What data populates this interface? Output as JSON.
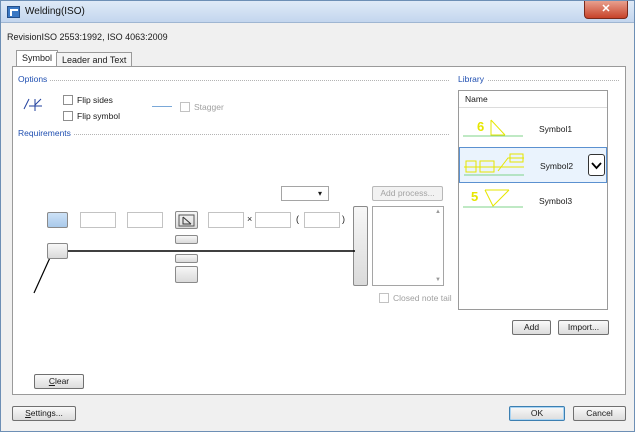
{
  "window": {
    "title": "Welding(ISO)",
    "close_glyph": "✕"
  },
  "revision": "RevisionISO 2553:1992, ISO 4063:2009",
  "tabs": [
    {
      "label": "Symbol"
    },
    {
      "label": "Leader and Text"
    }
  ],
  "options": {
    "group_label": "Options",
    "flip_sides": {
      "label": "Flip sides",
      "checked": false
    },
    "flip_symbol": {
      "label": "Flip symbol",
      "checked": false
    },
    "stagger": {
      "label": "Stagger",
      "checked": false,
      "enabled": false
    }
  },
  "requirements": {
    "group_label": "Requirements",
    "dropdown_value": "",
    "add_process_label": "Add process...",
    "times_glyph": "×",
    "paren_open": "(",
    "paren_close": ")",
    "closed_note_tail": {
      "label": "Closed note tail",
      "checked": false,
      "enabled": false
    }
  },
  "library": {
    "group_label": "Library",
    "column_header": "Name",
    "items": [
      {
        "name": "Symbol1",
        "preview_value": "6",
        "color": "#e6e600"
      },
      {
        "name": "Symbol2",
        "preview_value": "",
        "color": "#e6e600",
        "selected": true
      },
      {
        "name": "Symbol3",
        "preview_value": "5",
        "color": "#e6e600"
      }
    ],
    "add_label": "Add",
    "import_label": "Import..."
  },
  "footer": {
    "clear_label": "Clear",
    "settings_label": "Settings...",
    "ok_label": "OK",
    "cancel_label": "Cancel"
  },
  "colors": {
    "accent": "#1f4fb1",
    "symbol_yellow": "#e6e600",
    "symbol_green": "#7fd38a",
    "close_red": "#c7432a"
  }
}
